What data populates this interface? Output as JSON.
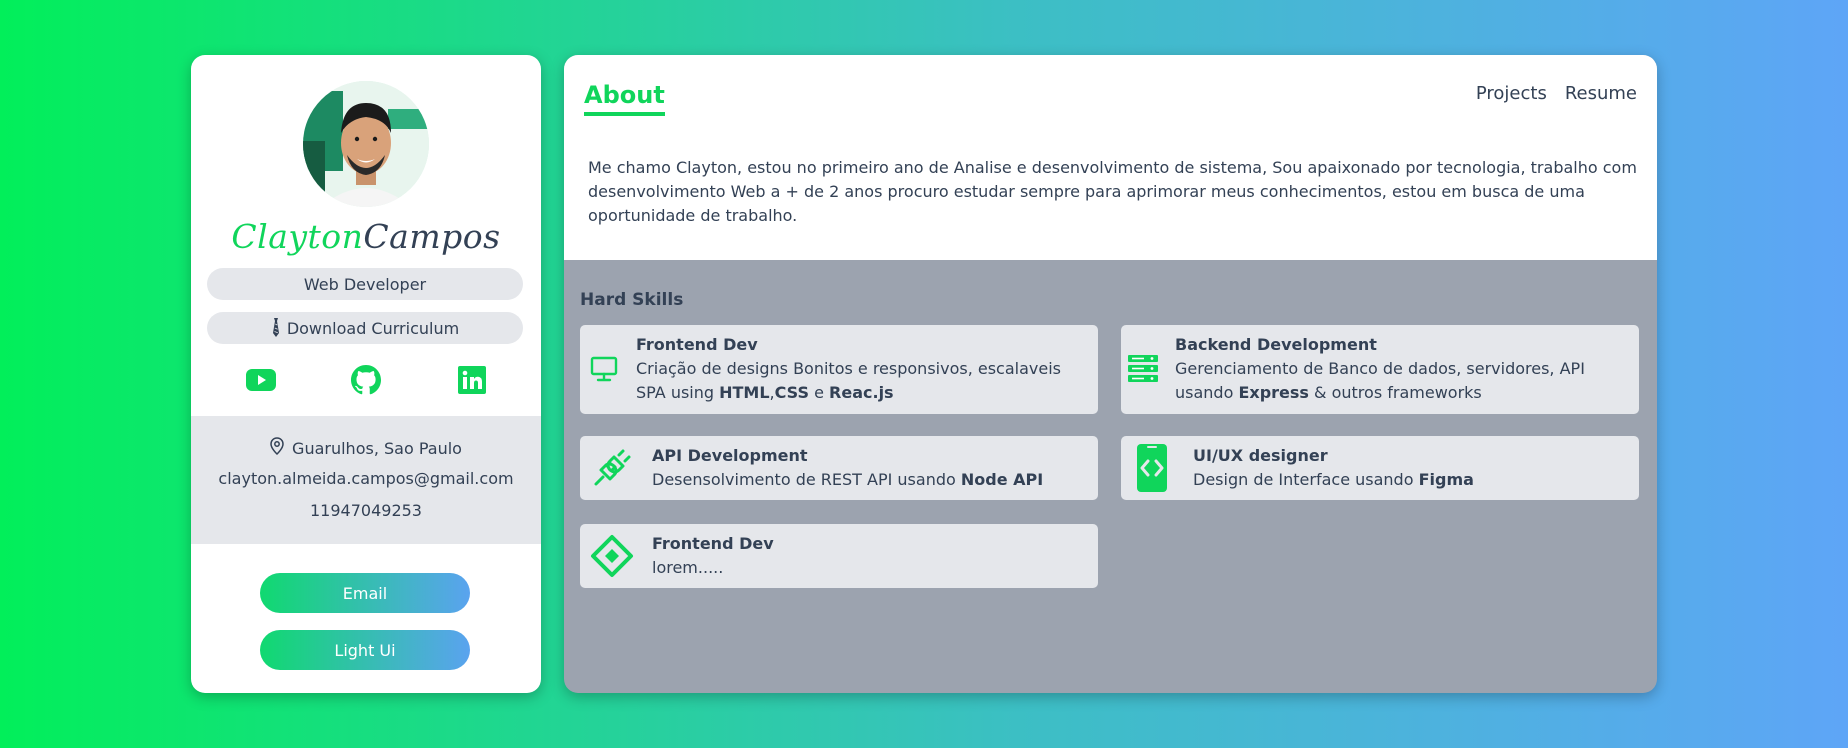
{
  "profile": {
    "name_first": "Clayton",
    "name_last": "Campos",
    "role": "Web Developer",
    "download_label": "Download Curriculum",
    "location": "Guarulhos, Sao Paulo",
    "email": "clayton.almeida.campos@gmail.com",
    "phone": "11947049253",
    "email_button": "Email",
    "theme_button": "Light Ui",
    "socials": [
      "youtube-icon",
      "github-icon",
      "linkedin-icon"
    ]
  },
  "main": {
    "active_tab": "About",
    "nav": [
      "Projects",
      "Resume"
    ],
    "about_text": "Me chamo Clayton, estou no primeiro ano de Analise e desenvolvimento de sistema, Sou apaixonado por tecnologia, trabalho com desenvolvimento Web a + de 2 anos procuro estudar sempre para aprimorar meus conhecimentos, estou em busca de uma oportunidade de trabalho.",
    "skills_title": "Hard Skills",
    "skills": [
      {
        "title": "Frontend Dev",
        "desc_pre": "Criação de designs Bonitos e responsivos, escalaveis SPA using ",
        "b1": "HTML",
        "sep1": ",",
        "b2": "CSS",
        "sep2": " e ",
        "b3": "Reac.js",
        "icon": "monitor-icon"
      },
      {
        "title": "Backend Development",
        "desc_pre": "Gerenciamento de Banco de dados, servidores, API usando ",
        "b1": "Express",
        "desc_post": " & outros frameworks",
        "icon": "server-icon"
      },
      {
        "title": "API Development",
        "desc_pre": "Desensolvimento de REST API usando ",
        "b1": "Node API",
        "icon": "plug-icon"
      },
      {
        "title": "UI/UX designer",
        "desc_pre": "Design de Interface usando ",
        "b1": "Figma",
        "icon": "mobile-code-icon"
      },
      {
        "title": "Frontend Dev",
        "desc_pre": "lorem.....",
        "icon": "diamond-logo-icon"
      }
    ]
  },
  "colors": {
    "accent": "#10d55b",
    "text": "#334155",
    "panel_gray": "#9ca3af",
    "card_gray": "#e5e7eb"
  }
}
